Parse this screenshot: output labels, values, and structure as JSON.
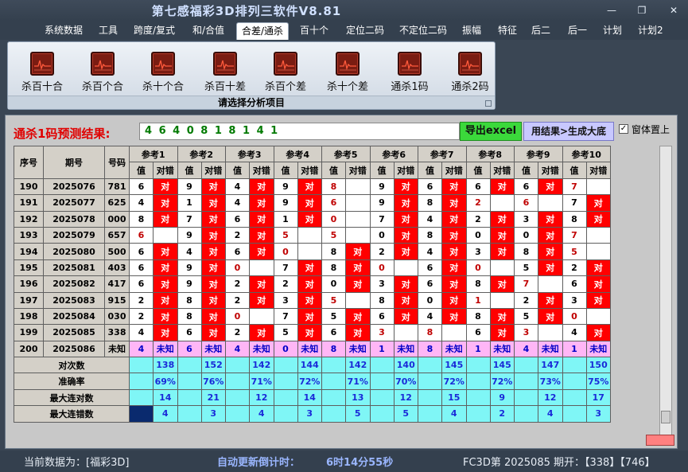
{
  "window": {
    "title": "第七感福彩3D排列三软件V8.81",
    "min": "—",
    "max": "❐",
    "close": "✕"
  },
  "menu": [
    "系统数据",
    "工具",
    "跨度/复式",
    "和/合值",
    "合差/通杀",
    "百十个",
    "定位二码",
    "不定位二码",
    "振幅",
    "特征",
    "后二",
    "后一",
    "计划",
    "计划2"
  ],
  "menu_active_index": 4,
  "ribbon": {
    "buttons": [
      "杀百十合",
      "杀百个合",
      "杀十个合",
      "杀百十差",
      "杀百个差",
      "杀十个差",
      "通杀1码",
      "通杀2码"
    ],
    "caption": "请选择分析项目"
  },
  "prediction": {
    "label": "通杀1码预测结果:",
    "value": "4 6 4 0 8 1 8 1 4 1",
    "export_button": "导出excel",
    "generate_button": "用结果>生成大底",
    "pin_label": "窗体置上",
    "pin_checked": "✓"
  },
  "table": {
    "col_seq": "序号",
    "col_period": "期号",
    "col_num": "号码",
    "ref_headers": [
      "参考1",
      "参考2",
      "参考3",
      "参考4",
      "参考5",
      "参考6",
      "参考7",
      "参考8",
      "参考9",
      "参考10"
    ],
    "sub_val": "值",
    "sub_res": "对错",
    "hit_text": "对",
    "rows": [
      {
        "seq": "190",
        "period": "2025076",
        "num": "781",
        "vals": [
          "6",
          "9",
          "4",
          "9",
          "8",
          "9",
          "6",
          "6",
          "6",
          "7"
        ],
        "hits": [
          1,
          1,
          1,
          1,
          0,
          1,
          1,
          1,
          1,
          0
        ]
      },
      {
        "seq": "191",
        "period": "2025077",
        "num": "625",
        "vals": [
          "4",
          "1",
          "4",
          "9",
          "6",
          "9",
          "8",
          "2",
          "6",
          "7"
        ],
        "hits": [
          1,
          1,
          1,
          1,
          0,
          1,
          1,
          0,
          0,
          1
        ]
      },
      {
        "seq": "192",
        "period": "2025078",
        "num": "000",
        "vals": [
          "8",
          "7",
          "6",
          "1",
          "0",
          "7",
          "4",
          "2",
          "3",
          "8"
        ],
        "hits": [
          1,
          1,
          1,
          1,
          0,
          1,
          1,
          1,
          1,
          1
        ]
      },
      {
        "seq": "193",
        "period": "2025079",
        "num": "657",
        "vals": [
          "6",
          "9",
          "2",
          "5",
          "5",
          "0",
          "8",
          "0",
          "0",
          "7"
        ],
        "hits": [
          0,
          1,
          1,
          0,
          0,
          1,
          1,
          1,
          1,
          0
        ]
      },
      {
        "seq": "194",
        "period": "2025080",
        "num": "500",
        "vals": [
          "6",
          "4",
          "6",
          "0",
          "8",
          "2",
          "4",
          "3",
          "8",
          "5"
        ],
        "hits": [
          1,
          1,
          1,
          0,
          1,
          1,
          1,
          1,
          1,
          0
        ]
      },
      {
        "seq": "195",
        "period": "2025081",
        "num": "403",
        "vals": [
          "6",
          "9",
          "0",
          "7",
          "8",
          "0",
          "6",
          "0",
          "5",
          "2"
        ],
        "hits": [
          1,
          1,
          0,
          1,
          1,
          0,
          1,
          0,
          1,
          1
        ]
      },
      {
        "seq": "196",
        "period": "2025082",
        "num": "417",
        "vals": [
          "6",
          "9",
          "2",
          "2",
          "0",
          "3",
          "6",
          "8",
          "7",
          "6"
        ],
        "hits": [
          1,
          1,
          1,
          1,
          1,
          1,
          1,
          1,
          0,
          1
        ]
      },
      {
        "seq": "197",
        "period": "2025083",
        "num": "915",
        "vals": [
          "2",
          "8",
          "2",
          "3",
          "5",
          "8",
          "0",
          "1",
          "2",
          "3"
        ],
        "hits": [
          1,
          1,
          1,
          1,
          0,
          1,
          1,
          0,
          1,
          1
        ]
      },
      {
        "seq": "198",
        "period": "2025084",
        "num": "030",
        "vals": [
          "2",
          "8",
          "0",
          "7",
          "5",
          "6",
          "4",
          "8",
          "5",
          "0"
        ],
        "hits": [
          1,
          1,
          0,
          1,
          1,
          1,
          1,
          1,
          1,
          0
        ]
      },
      {
        "seq": "199",
        "period": "2025085",
        "num": "338",
        "vals": [
          "4",
          "6",
          "2",
          "5",
          "6",
          "3",
          "8",
          "6",
          "3",
          "4"
        ],
        "hits": [
          1,
          1,
          1,
          1,
          1,
          0,
          0,
          1,
          0,
          1
        ]
      }
    ],
    "pending_row": {
      "seq": "200",
      "period": "2025086",
      "num": "未知",
      "vals": [
        "4",
        "6",
        "4",
        "0",
        "8",
        "1",
        "8",
        "1",
        "4",
        "1"
      ],
      "res": "未知"
    },
    "stats": [
      {
        "label": "对次数",
        "values": [
          "138",
          "152",
          "142",
          "144",
          "142",
          "140",
          "145",
          "145",
          "147",
          "150"
        ]
      },
      {
        "label": "准确率",
        "values": [
          "69%",
          "76%",
          "71%",
          "72%",
          "71%",
          "70%",
          "72%",
          "72%",
          "73%",
          "75%"
        ]
      },
      {
        "label": "最大连对数",
        "values": [
          "14",
          "21",
          "12",
          "14",
          "13",
          "12",
          "15",
          "9",
          "12",
          "17"
        ]
      },
      {
        "label": "最大连错数",
        "values": [
          "4",
          "3",
          "4",
          "3",
          "5",
          "5",
          "4",
          "2",
          "4",
          "3"
        ]
      }
    ]
  },
  "status": {
    "current_data": "当前数据为：[福彩3D]",
    "countdown_label": "自动更新倒计时：",
    "countdown": "6时14分55秒",
    "draw": "FC3D第 2025085 期开：【338】【746】"
  }
}
